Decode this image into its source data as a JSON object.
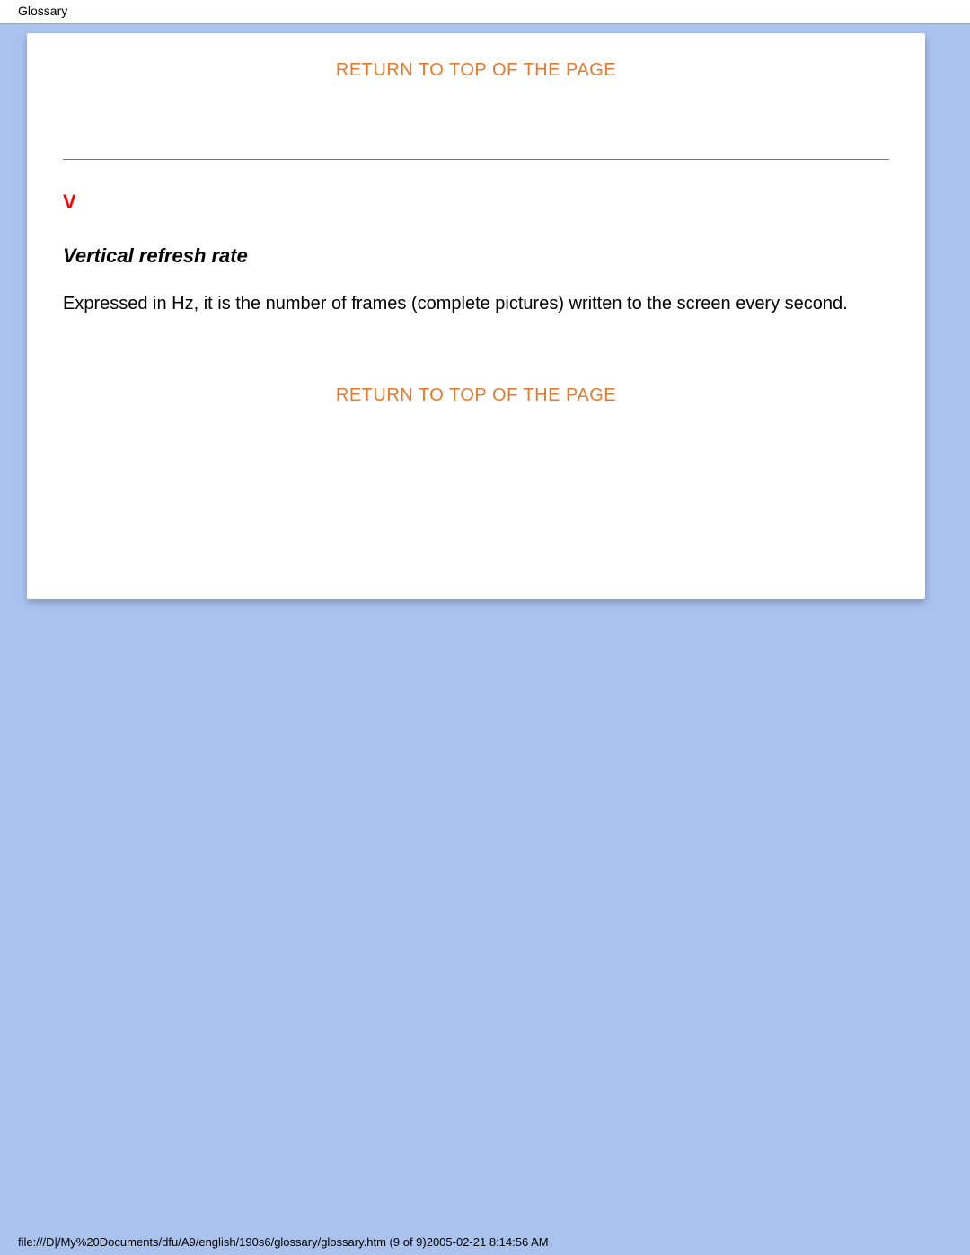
{
  "header": {
    "title": "Glossary"
  },
  "links": {
    "return_top_1": "RETURN TO TOP OF THE PAGE",
    "return_top_2": "RETURN TO TOP OF THE PAGE"
  },
  "section": {
    "letter": "V",
    "term": "Vertical refresh rate",
    "definition": "Expressed in Hz, it is the number of frames (complete pictures) written to the screen every second."
  },
  "footer": {
    "status": "file:///D|/My%20Documents/dfu/A9/english/190s6/glossary/glossary.htm (9 of 9)2005-02-21 8:14:56 AM"
  }
}
